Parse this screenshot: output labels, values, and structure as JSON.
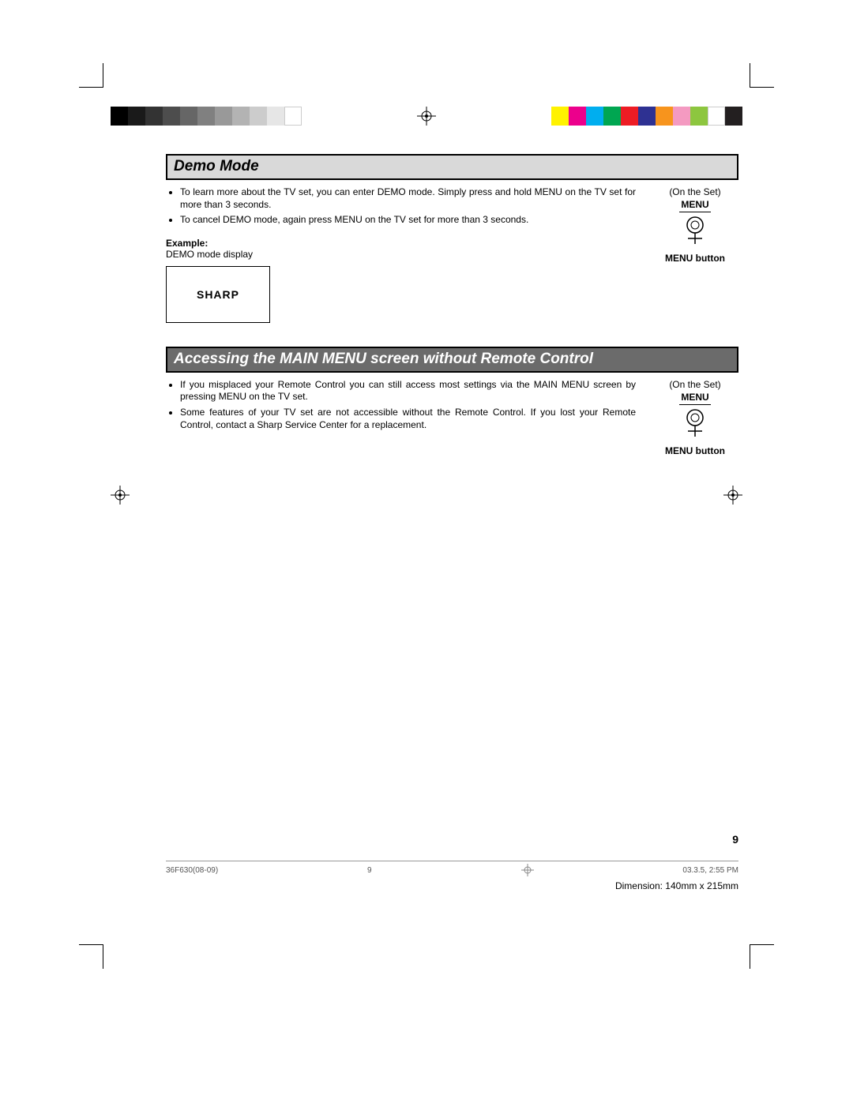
{
  "section1": {
    "title": "Demo Mode",
    "bullets": [
      "To learn more about the TV set, you can enter DEMO mode. Simply press and hold MENU on the TV set for more than 3 seconds.",
      "To cancel DEMO mode, again press MENU on the TV set for more than 3 seconds."
    ],
    "example_label": "Example:",
    "example_sub": "DEMO mode display",
    "sharp_logo": "SHARP",
    "on_set": "(On the Set)",
    "menu": "MENU",
    "menu_button": "MENU button"
  },
  "section2": {
    "title": "Accessing the MAIN MENU screen without Remote Control",
    "bullets": [
      "If you misplaced your Remote Control you can still access most settings via the MAIN MENU screen by pressing MENU on the TV set.",
      "Some features of your TV set are not accessible without the Remote Control. If you lost your Remote Control, contact a Sharp Service Center for a replacement."
    ],
    "on_set": "(On the Set)",
    "menu": "MENU",
    "menu_button": "MENU button"
  },
  "page_number": "9",
  "footer": {
    "left": "36F630(08-09)",
    "center": "9",
    "right": "03.3.5, 2:55 PM"
  },
  "dimension": "Dimension: 140mm x 215mm"
}
